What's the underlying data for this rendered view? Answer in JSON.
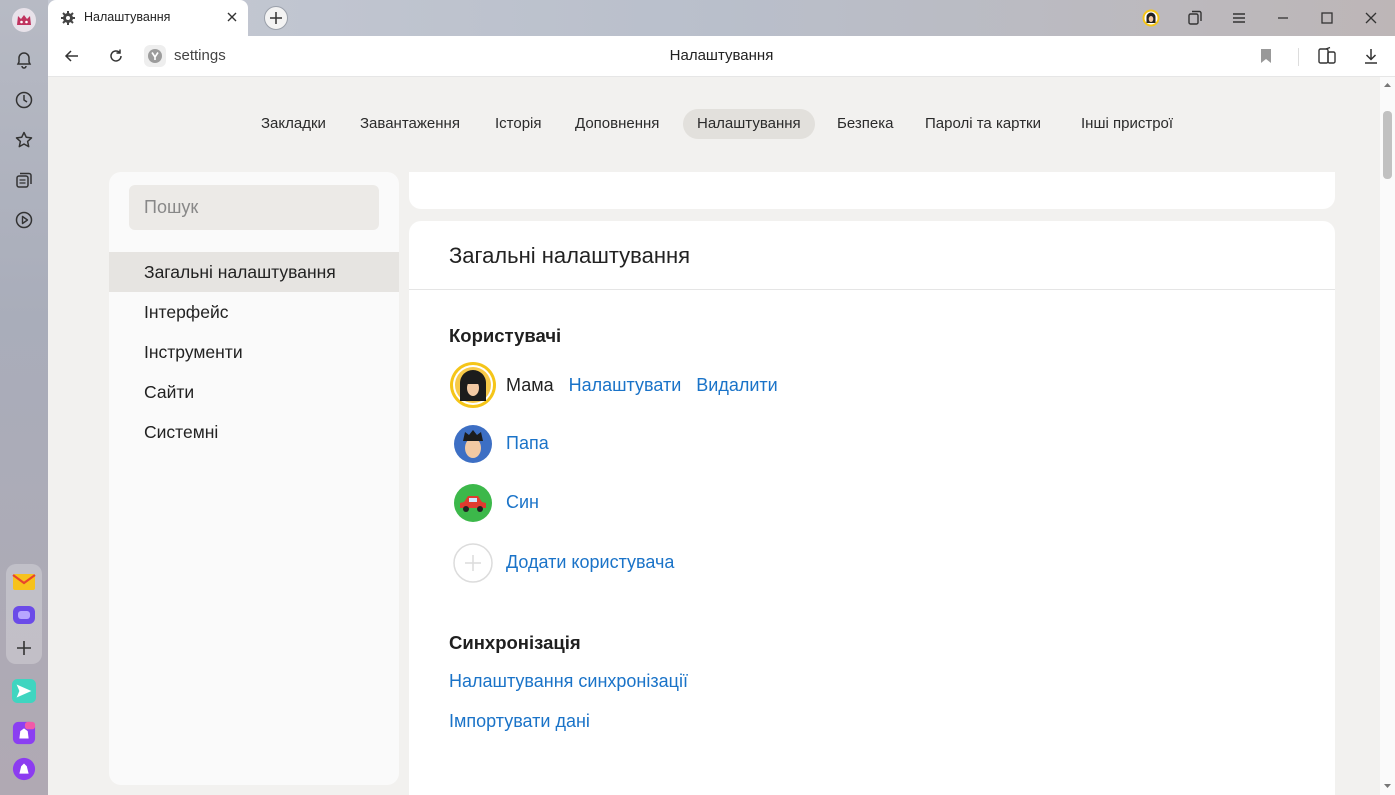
{
  "browser": {
    "tab": {
      "title": "Налаштування",
      "icon": "gear-icon"
    },
    "address": {
      "url": "settings",
      "page_title": "Налаштування"
    }
  },
  "sidebar_icons": [
    "profile-avatar-icon",
    "bell-icon",
    "clock-icon",
    "star-icon",
    "collections-icon",
    "play-icon",
    "mail-icon",
    "messenger-icon",
    "add-icon",
    "send-icon",
    "disk-icon",
    "alice-icon"
  ],
  "nav": {
    "items": [
      {
        "label": "Закладки"
      },
      {
        "label": "Завантаження"
      },
      {
        "label": "Історія"
      },
      {
        "label": "Доповнення"
      },
      {
        "label": "Налаштування",
        "active": true
      },
      {
        "label": "Безпека"
      },
      {
        "label": "Паролі та картки"
      },
      {
        "label": "Інші пристрої"
      }
    ]
  },
  "left_panel": {
    "search_placeholder": "Пошук",
    "items": [
      {
        "label": "Загальні налаштування",
        "active": true
      },
      {
        "label": "Інтерфейс"
      },
      {
        "label": "Інструменти"
      },
      {
        "label": "Сайти"
      },
      {
        "label": "Системні"
      }
    ]
  },
  "main": {
    "title": "Загальні налаштування",
    "users_section": {
      "heading": "Користувачі",
      "users": [
        {
          "name": "Мама",
          "current": true,
          "configure": "Налаштувати",
          "delete": "Видалити"
        },
        {
          "name": "Папа"
        },
        {
          "name": "Син"
        }
      ],
      "add_user": "Додати користувача"
    },
    "sync_section": {
      "heading": "Синхронізація",
      "sync_settings": "Налаштування синхронізації",
      "import_data": "Імпортувати дані"
    }
  },
  "colors": {
    "link": "#1a73c8",
    "accent_ring": "#f5c518",
    "page_bg": "#f2f1ef"
  }
}
